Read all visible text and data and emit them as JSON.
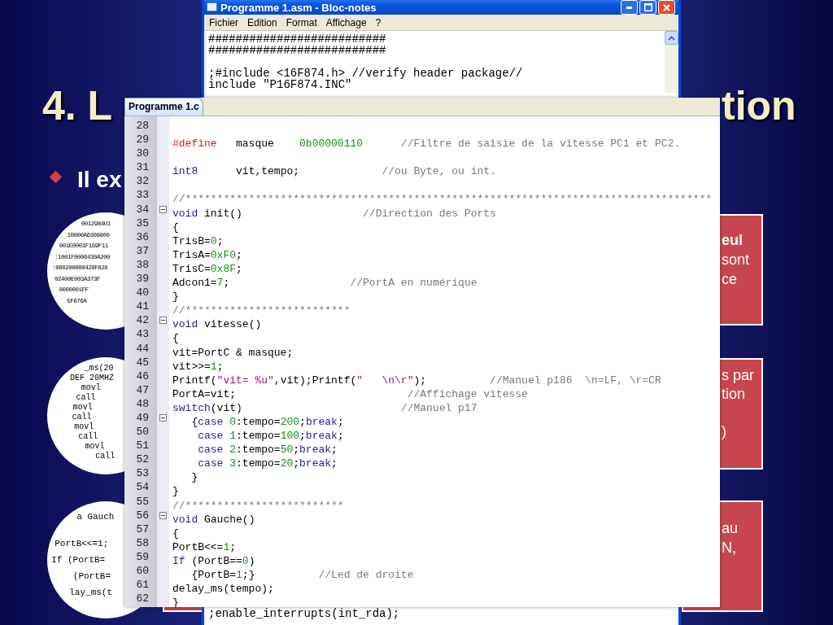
{
  "slide": {
    "title_parts": [
      "4. L",
      "tion"
    ],
    "bullet": "Il ex",
    "circles": [
      {
        "lines": [
          "0012984U1",
          "10000A6309800",
          "001E0001F159F11",
          ":1001F0006430A200",
          ":060200000428F828",
          "02400E003A373F",
          "0000001FF",
          "5F876A"
        ]
      },
      {
        "lines": [
          "_ms(20",
          "DEF 20MHZ",
          "    movl",
          "    call",
          "    movl",
          "    call",
          "    movl",
          "    call",
          "    movl",
          "    call"
        ]
      },
      {
        "lines": [
          "a Gauch",
          "PortB<<=1;",
          "If (PortB=",
          "   (PortB=",
          "lay_ms(t"
        ]
      }
    ],
    "callouts": [
      {
        "lines": [
          {
            "text": "eul",
            "bold": true
          },
          {
            "text": "sont",
            "bold": false
          },
          {
            "text": "ce",
            "bold": false
          }
        ]
      },
      {
        "lines": [
          {
            "text": "s par",
            "bold": false
          },
          {
            "text": "tion",
            "bold": false
          },
          {
            "text": ")",
            "bold": false
          }
        ]
      },
      {
        "lines": [
          {
            "text": "au",
            "bold": false
          },
          {
            "text": "N,",
            "bold": false
          }
        ]
      }
    ]
  },
  "notepad": {
    "title": "Programme 1.asm - Bloc-notes",
    "menu": [
      "Fichier",
      "Edition",
      "Format",
      "Affichage",
      "?"
    ],
    "text": "##########################\n##########################\n\n;#include <16F874.h> //verify header package//\ninclude \"P16F874.INC\"",
    "bottom_line": ";enable_interrupts(int_rda);"
  },
  "editor": {
    "tab": "Programme 1.c",
    "lines": [
      {
        "n": "28",
        "fold": false
      },
      {
        "n": "29",
        "fold": false,
        "tokens": [
          {
            "kind": "pre",
            "text": "#define"
          },
          {
            "kind": "plain",
            "text": "   masque    "
          },
          {
            "kind": "num",
            "text": "0b00000110"
          },
          {
            "kind": "cmt",
            "text": "      //Filtre de saisie de la vitesse PC1 et PC2."
          }
        ]
      },
      {
        "n": "30",
        "fold": false
      },
      {
        "n": "31",
        "fold": false,
        "tokens": [
          {
            "kind": "kw",
            "text": "int8"
          },
          {
            "kind": "plain",
            "text": "      vit,tempo;"
          },
          {
            "kind": "cmt",
            "text": "             //ou Byte, ou int."
          }
        ]
      },
      {
        "n": "32",
        "fold": false
      },
      {
        "n": "33",
        "fold": false,
        "tokens": [
          {
            "kind": "cmt",
            "text": "//***********************************************************************************"
          }
        ]
      },
      {
        "n": "34",
        "fold": true,
        "tokens": [
          {
            "kind": "kw",
            "text": "void"
          },
          {
            "kind": "plain",
            "text": " init()"
          },
          {
            "kind": "cmt",
            "text": "                   //Direction des Ports"
          }
        ]
      },
      {
        "n": "35",
        "fold": false,
        "tokens": [
          {
            "kind": "plain",
            "text": "{"
          }
        ]
      },
      {
        "n": "36",
        "fold": false,
        "tokens": [
          {
            "kind": "plain",
            "text": "TrisB="
          },
          {
            "kind": "num",
            "text": "0"
          },
          {
            "kind": "plain",
            "text": ";"
          }
        ]
      },
      {
        "n": "37",
        "fold": false,
        "tokens": [
          {
            "kind": "plain",
            "text": "TrisA="
          },
          {
            "kind": "num",
            "text": "0xF0"
          },
          {
            "kind": "plain",
            "text": ";"
          }
        ]
      },
      {
        "n": "38",
        "fold": false,
        "tokens": [
          {
            "kind": "plain",
            "text": "TrisC="
          },
          {
            "kind": "num",
            "text": "0x8F"
          },
          {
            "kind": "plain",
            "text": ";"
          }
        ]
      },
      {
        "n": "39",
        "fold": false,
        "tokens": [
          {
            "kind": "plain",
            "text": "Adcon1="
          },
          {
            "kind": "num",
            "text": "7"
          },
          {
            "kind": "plain",
            "text": ";"
          },
          {
            "kind": "cmt",
            "text": "                   //PortA en numérique"
          }
        ]
      },
      {
        "n": "40",
        "fold": false,
        "tokens": [
          {
            "kind": "plain",
            "text": "}"
          }
        ]
      },
      {
        "n": "41",
        "fold": false,
        "tokens": [
          {
            "kind": "cmt",
            "text": "//**************************"
          }
        ]
      },
      {
        "n": "42",
        "fold": true,
        "tokens": [
          {
            "kind": "kw",
            "text": "void"
          },
          {
            "kind": "plain",
            "text": " vitesse()"
          }
        ]
      },
      {
        "n": "43",
        "fold": false,
        "tokens": [
          {
            "kind": "plain",
            "text": "{"
          }
        ]
      },
      {
        "n": "44",
        "fold": false,
        "tokens": [
          {
            "kind": "plain",
            "text": "vit=PortC & masque;"
          }
        ]
      },
      {
        "n": "45",
        "fold": false,
        "tokens": [
          {
            "kind": "plain",
            "text": "vit>>="
          },
          {
            "kind": "num",
            "text": "1"
          },
          {
            "kind": "plain",
            "text": ";"
          }
        ]
      },
      {
        "n": "46",
        "fold": false,
        "tokens": [
          {
            "kind": "plain",
            "text": "Printf("
          },
          {
            "kind": "str",
            "text": "\"vit= %u\""
          },
          {
            "kind": "plain",
            "text": ",vit);Printf("
          },
          {
            "kind": "str",
            "text": "\"   \\n\\r\""
          },
          {
            "kind": "plain",
            "text": ");"
          },
          {
            "kind": "cmt",
            "text": "          //Manuel p186  \\n=LF, \\r=CR"
          }
        ]
      },
      {
        "n": "47",
        "fold": false,
        "tokens": [
          {
            "kind": "plain",
            "text": "PortA=vit;"
          },
          {
            "kind": "cmt",
            "text": "                           //Affichage vitesse"
          }
        ]
      },
      {
        "n": "48",
        "fold": false,
        "tokens": [
          {
            "kind": "kw",
            "text": "switch"
          },
          {
            "kind": "plain",
            "text": "(vit)"
          },
          {
            "kind": "cmt",
            "text": "                         //Manuel p17"
          }
        ]
      },
      {
        "n": "49",
        "fold": true,
        "tokens": [
          {
            "kind": "plain",
            "text": "   {"
          },
          {
            "kind": "kw",
            "text": "case"
          },
          {
            "kind": "num",
            "text": " 0"
          },
          {
            "kind": "plain",
            "text": ":tempo="
          },
          {
            "kind": "num",
            "text": "200"
          },
          {
            "kind": "plain",
            "text": ";"
          },
          {
            "kind": "kw",
            "text": "break"
          },
          {
            "kind": "plain",
            "text": ";"
          }
        ]
      },
      {
        "n": "50",
        "fold": false,
        "tokens": [
          {
            "kind": "kw",
            "text": "    case"
          },
          {
            "kind": "num",
            "text": " 1"
          },
          {
            "kind": "plain",
            "text": ":tempo="
          },
          {
            "kind": "num",
            "text": "100"
          },
          {
            "kind": "plain",
            "text": ";"
          },
          {
            "kind": "kw",
            "text": "break"
          },
          {
            "kind": "plain",
            "text": ";"
          }
        ]
      },
      {
        "n": "51",
        "fold": false,
        "tokens": [
          {
            "kind": "kw",
            "text": "    case"
          },
          {
            "kind": "num",
            "text": " 2"
          },
          {
            "kind": "plain",
            "text": ":tempo="
          },
          {
            "kind": "num",
            "text": "50"
          },
          {
            "kind": "plain",
            "text": ";"
          },
          {
            "kind": "kw",
            "text": "break"
          },
          {
            "kind": "plain",
            "text": ";"
          }
        ]
      },
      {
        "n": "52",
        "fold": false,
        "tokens": [
          {
            "kind": "kw",
            "text": "    case"
          },
          {
            "kind": "num",
            "text": " 3"
          },
          {
            "kind": "plain",
            "text": ":tempo="
          },
          {
            "kind": "num",
            "text": "20"
          },
          {
            "kind": "plain",
            "text": ";"
          },
          {
            "kind": "kw",
            "text": "break"
          },
          {
            "kind": "plain",
            "text": ";"
          }
        ]
      },
      {
        "n": "53",
        "fold": false,
        "tokens": [
          {
            "kind": "plain",
            "text": "   }"
          }
        ]
      },
      {
        "n": "54",
        "fold": false,
        "tokens": [
          {
            "kind": "plain",
            "text": "}"
          }
        ]
      },
      {
        "n": "55",
        "fold": false,
        "tokens": [
          {
            "kind": "cmt",
            "text": "//*************************"
          }
        ]
      },
      {
        "n": "56",
        "fold": true,
        "tokens": [
          {
            "kind": "kw",
            "text": "void"
          },
          {
            "kind": "plain",
            "text": " Gauche()"
          }
        ]
      },
      {
        "n": "57",
        "fold": false,
        "tokens": [
          {
            "kind": "plain",
            "text": "{"
          }
        ]
      },
      {
        "n": "58",
        "fold": false,
        "tokens": [
          {
            "kind": "plain",
            "text": "PortB<<="
          },
          {
            "kind": "num",
            "text": "1"
          },
          {
            "kind": "plain",
            "text": ";"
          }
        ]
      },
      {
        "n": "59",
        "fold": false,
        "tokens": [
          {
            "kind": "kw",
            "text": "If"
          },
          {
            "kind": "plain",
            "text": " (PortB=="
          },
          {
            "kind": "num",
            "text": "0"
          },
          {
            "kind": "plain",
            "text": ")"
          }
        ]
      },
      {
        "n": "60",
        "fold": false,
        "tokens": [
          {
            "kind": "plain",
            "text": "   {PortB="
          },
          {
            "kind": "num",
            "text": "1"
          },
          {
            "kind": "plain",
            "text": ";}"
          },
          {
            "kind": "cmt",
            "text": "          //Led de droite"
          }
        ]
      },
      {
        "n": "61",
        "fold": false,
        "tokens": [
          {
            "kind": "plain",
            "text": "delay_ms(tempo);"
          }
        ]
      },
      {
        "n": "62",
        "fold": false,
        "tokens": [
          {
            "kind": "plain",
            "text": "}"
          }
        ]
      }
    ]
  }
}
